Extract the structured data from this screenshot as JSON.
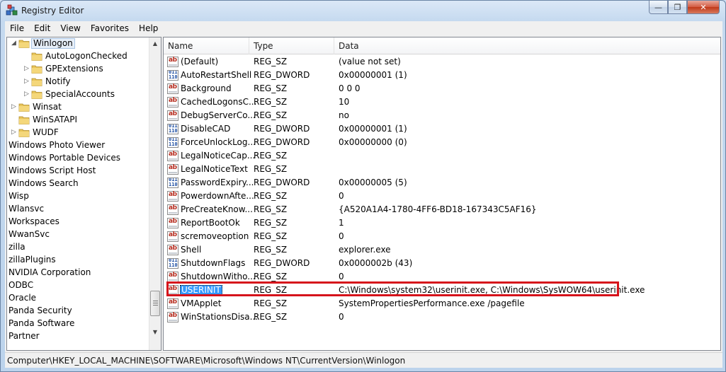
{
  "window": {
    "title": "Registry Editor"
  },
  "menu": [
    "File",
    "Edit",
    "View",
    "Favorites",
    "Help"
  ],
  "tree": [
    {
      "label": "Winlogon",
      "indent": 1,
      "expander": "open",
      "selected": true
    },
    {
      "label": "AutoLogonChecked",
      "indent": 2,
      "expander": "none"
    },
    {
      "label": "GPExtensions",
      "indent": 2,
      "expander": "closed"
    },
    {
      "label": "Notify",
      "indent": 2,
      "expander": "closed"
    },
    {
      "label": "SpecialAccounts",
      "indent": 2,
      "expander": "closed"
    },
    {
      "label": "Winsat",
      "indent": 1,
      "expander": "closed"
    },
    {
      "label": "WinSATAPI",
      "indent": 1,
      "expander": "none"
    },
    {
      "label": "WUDF",
      "indent": 1,
      "expander": "closed"
    },
    {
      "label": "Windows Photo Viewer",
      "indent": 0,
      "expander": "none"
    },
    {
      "label": "Windows Portable Devices",
      "indent": 0,
      "expander": "none"
    },
    {
      "label": "Windows Script Host",
      "indent": 0,
      "expander": "none"
    },
    {
      "label": "Windows Search",
      "indent": 0,
      "expander": "none"
    },
    {
      "label": "Wisp",
      "indent": 0,
      "expander": "none"
    },
    {
      "label": "Wlansvc",
      "indent": 0,
      "expander": "none"
    },
    {
      "label": "Workspaces",
      "indent": 0,
      "expander": "none"
    },
    {
      "label": "WwanSvc",
      "indent": 0,
      "expander": "none"
    },
    {
      "label": "zilla",
      "indent": 0,
      "expander": "none"
    },
    {
      "label": "zillaPlugins",
      "indent": 0,
      "expander": "none"
    },
    {
      "label": "NVIDIA Corporation",
      "indent": 0,
      "expander": "none"
    },
    {
      "label": "ODBC",
      "indent": 0,
      "expander": "none"
    },
    {
      "label": "Oracle",
      "indent": 0,
      "expander": "none"
    },
    {
      "label": "Panda Security",
      "indent": 0,
      "expander": "none"
    },
    {
      "label": "Panda Software",
      "indent": 0,
      "expander": "none"
    },
    {
      "label": "Partner",
      "indent": 0,
      "expander": "none"
    }
  ],
  "columns": {
    "name": "Name",
    "type": "Type",
    "data": "Data"
  },
  "values": [
    {
      "name": "(Default)",
      "type": "REG_SZ",
      "data": "(value not set)",
      "icon": "string-value-icon"
    },
    {
      "name": "AutoRestartShell",
      "type": "REG_DWORD",
      "data": "0x00000001 (1)",
      "icon": "binary-value-icon"
    },
    {
      "name": "Background",
      "type": "REG_SZ",
      "data": "0 0 0",
      "icon": "string-value-icon"
    },
    {
      "name": "CachedLogonsC...",
      "type": "REG_SZ",
      "data": "10",
      "icon": "string-value-icon"
    },
    {
      "name": "DebugServerCo...",
      "type": "REG_SZ",
      "data": "no",
      "icon": "string-value-icon"
    },
    {
      "name": "DisableCAD",
      "type": "REG_DWORD",
      "data": "0x00000001 (1)",
      "icon": "binary-value-icon"
    },
    {
      "name": "ForceUnlockLog...",
      "type": "REG_DWORD",
      "data": "0x00000000 (0)",
      "icon": "binary-value-icon"
    },
    {
      "name": "LegalNoticeCap...",
      "type": "REG_SZ",
      "data": "",
      "icon": "string-value-icon"
    },
    {
      "name": "LegalNoticeText",
      "type": "REG_SZ",
      "data": "",
      "icon": "string-value-icon"
    },
    {
      "name": "PasswordExpiry...",
      "type": "REG_DWORD",
      "data": "0x00000005 (5)",
      "icon": "binary-value-icon"
    },
    {
      "name": "PowerdownAfte...",
      "type": "REG_SZ",
      "data": "0",
      "icon": "string-value-icon"
    },
    {
      "name": "PreCreateKnow...",
      "type": "REG_SZ",
      "data": "{A520A1A4-1780-4FF6-BD18-167343C5AF16}",
      "icon": "string-value-icon"
    },
    {
      "name": "ReportBootOk",
      "type": "REG_SZ",
      "data": "1",
      "icon": "string-value-icon"
    },
    {
      "name": "scremoveoption",
      "type": "REG_SZ",
      "data": "0",
      "icon": "string-value-icon"
    },
    {
      "name": "Shell",
      "type": "REG_SZ",
      "data": "explorer.exe",
      "icon": "string-value-icon"
    },
    {
      "name": "ShutdownFlags",
      "type": "REG_DWORD",
      "data": "0x0000002b (43)",
      "icon": "binary-value-icon"
    },
    {
      "name": "ShutdownWitho...",
      "type": "REG_SZ",
      "data": "0",
      "icon": "string-value-icon"
    },
    {
      "name": "USERINIT",
      "type": "REG_SZ",
      "data": "C:\\Windows\\system32\\userinit.exe, C:\\Windows\\SysWOW64\\userinit.exe",
      "icon": "string-value-icon",
      "selected": true
    },
    {
      "name": "VMApplet",
      "type": "REG_SZ",
      "data": "SystemPropertiesPerformance.exe /pagefile",
      "icon": "string-value-icon"
    },
    {
      "name": "WinStationsDisa...",
      "type": "REG_SZ",
      "data": "0",
      "icon": "string-value-icon"
    }
  ],
  "status": {
    "path": "Computer\\HKEY_LOCAL_MACHINE\\SOFTWARE\\Microsoft\\Windows NT\\CurrentVersion\\Winlogon"
  },
  "colors": {
    "selection": "#3399ff",
    "highlight_box": "#d6131b",
    "folder": "#e8c55a"
  }
}
